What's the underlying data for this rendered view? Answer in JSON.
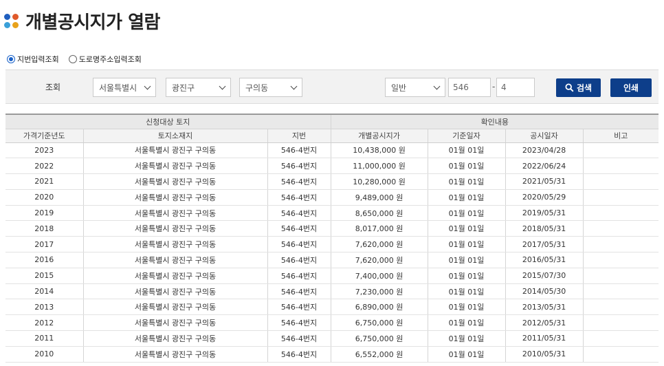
{
  "page": {
    "title": "개별공시지가 열람",
    "title_dot_colors": [
      "#1f5fbf",
      "#e05a2b",
      "#3aa0d9",
      "#e8a21b"
    ]
  },
  "search_mode": {
    "options": [
      "지번입력조회",
      "도로명주소입력조회"
    ],
    "selected": "지번입력조회"
  },
  "search_bar": {
    "label": "조회",
    "sido": "서울특별시",
    "sigungu": "광진구",
    "dong": "구의동",
    "land_type": "일반",
    "bonbun": "546",
    "dash": "-",
    "bubun": "4",
    "search_button": "검색",
    "print_button": "인쇄"
  },
  "table": {
    "groups": [
      "신청대상 토지",
      "확인내용"
    ],
    "columns": [
      "가격기준년도",
      "토지소재지",
      "지번",
      "개별공시지가",
      "기준일자",
      "공시일자",
      "비고"
    ],
    "rows": [
      [
        "2023",
        "서울특별시 광진구 구의동",
        "546-4번지",
        "10,438,000 원",
        "01월 01일",
        "2023/04/28",
        ""
      ],
      [
        "2022",
        "서울특별시 광진구 구의동",
        "546-4번지",
        "11,000,000 원",
        "01월 01일",
        "2022/06/24",
        ""
      ],
      [
        "2021",
        "서울특별시 광진구 구의동",
        "546-4번지",
        "10,280,000 원",
        "01월 01일",
        "2021/05/31",
        ""
      ],
      [
        "2020",
        "서울특별시 광진구 구의동",
        "546-4번지",
        "9,489,000 원",
        "01월 01일",
        "2020/05/29",
        ""
      ],
      [
        "2019",
        "서울특별시 광진구 구의동",
        "546-4번지",
        "8,650,000 원",
        "01월 01일",
        "2019/05/31",
        ""
      ],
      [
        "2018",
        "서울특별시 광진구 구의동",
        "546-4번지",
        "8,017,000 원",
        "01월 01일",
        "2018/05/31",
        ""
      ],
      [
        "2017",
        "서울특별시 광진구 구의동",
        "546-4번지",
        "7,620,000 원",
        "01월 01일",
        "2017/05/31",
        ""
      ],
      [
        "2016",
        "서울특별시 광진구 구의동",
        "546-4번지",
        "7,620,000 원",
        "01월 01일",
        "2016/05/31",
        ""
      ],
      [
        "2015",
        "서울특별시 광진구 구의동",
        "546-4번지",
        "7,400,000 원",
        "01월 01일",
        "2015/07/30",
        ""
      ],
      [
        "2014",
        "서울특별시 광진구 구의동",
        "546-4번지",
        "7,230,000 원",
        "01월 01일",
        "2014/05/30",
        ""
      ],
      [
        "2013",
        "서울특별시 광진구 구의동",
        "546-4번지",
        "6,890,000 원",
        "01월 01일",
        "2013/05/31",
        ""
      ],
      [
        "2012",
        "서울특별시 광진구 구의동",
        "546-4번지",
        "6,750,000 원",
        "01월 01일",
        "2012/05/31",
        ""
      ],
      [
        "2011",
        "서울특별시 광진구 구의동",
        "546-4번지",
        "6,750,000 원",
        "01월 01일",
        "2011/05/31",
        ""
      ],
      [
        "2010",
        "서울특별시 광진구 구의동",
        "546-4번지",
        "6,552,000 원",
        "01월 01일",
        "2010/05/31",
        ""
      ]
    ]
  }
}
